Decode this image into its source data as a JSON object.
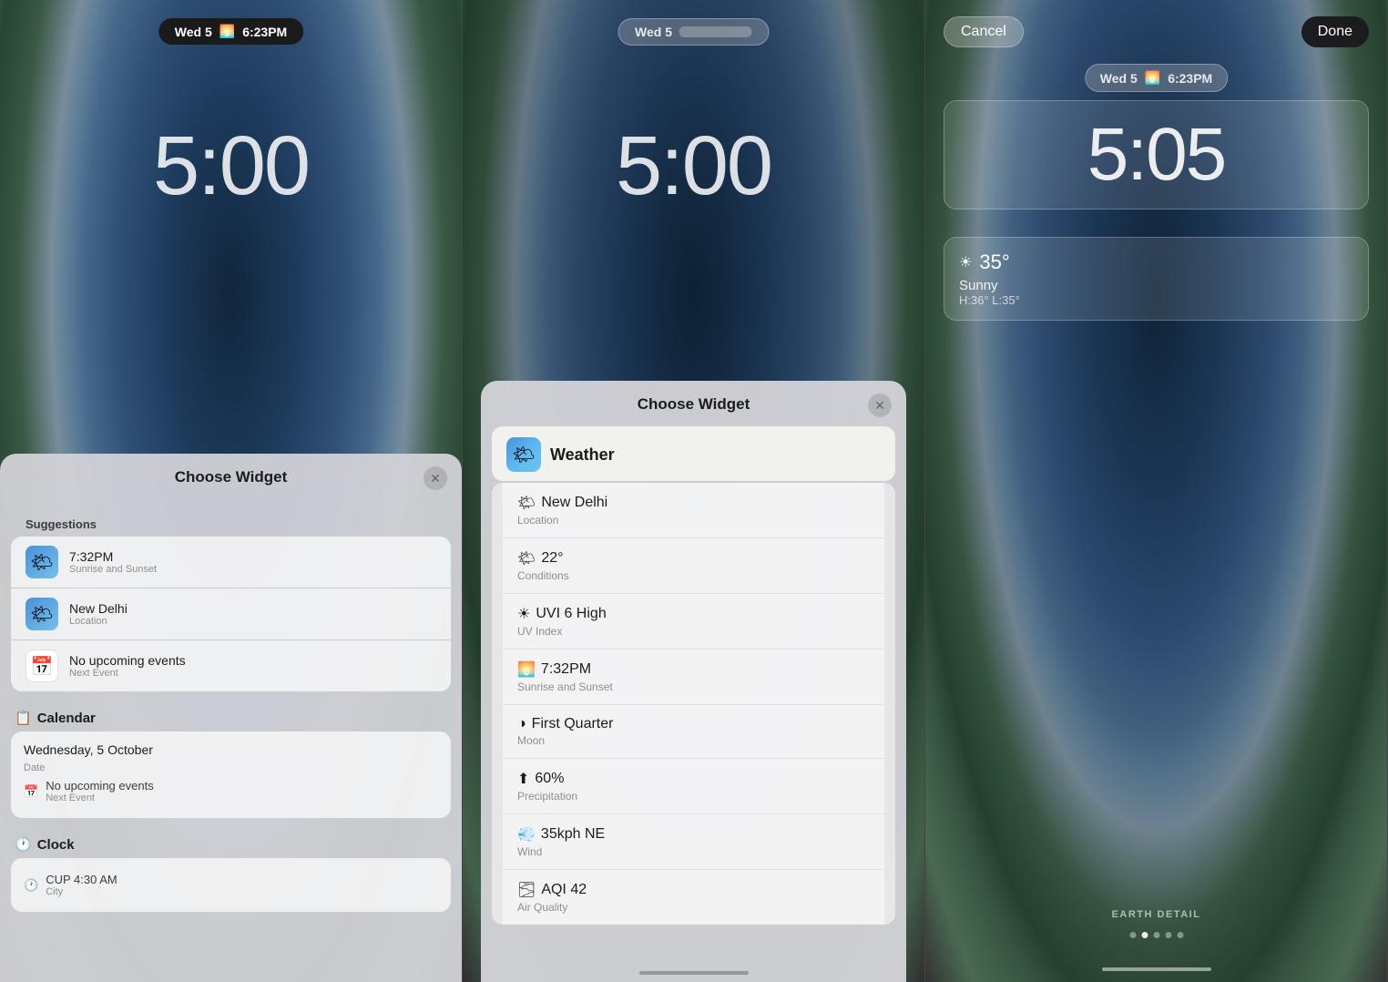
{
  "panels": [
    {
      "id": "panel1",
      "statusBar": {
        "text": "Wed 5",
        "time": "6:23PM",
        "icon": "🌅",
        "style": "dark"
      },
      "clock": "5:00",
      "sheet": {
        "title": "Choose Widget",
        "suggestions_label": "Suggestions",
        "items": [
          {
            "icon": "🌤",
            "type": "weather",
            "title": "7:32PM",
            "sub": "Sunrise and Sunset"
          },
          {
            "icon": "🌤",
            "type": "weather",
            "title": "New Delhi",
            "sub": "Location"
          },
          {
            "icon": "📅",
            "type": "calendar",
            "title": "No upcoming events",
            "sub": "Next Event"
          }
        ],
        "calendar_label": "Calendar",
        "calendar_date": "Wednesday, 5 October",
        "calendar_date_sub": "Date",
        "calendar_items": [
          {
            "icon": "📅",
            "title": "No upcoming events",
            "sub": "Next Event"
          }
        ],
        "clock_label": "Clock",
        "clock_items": [
          {
            "icon": "🕐",
            "title": "CUP 4:30 AM",
            "sub": "City"
          }
        ]
      }
    },
    {
      "id": "panel2",
      "statusBar": {
        "text": "Wed 5",
        "style": "light"
      },
      "clock": "5:00",
      "sheet": {
        "title": "Choose Widget",
        "app_name": "Weather",
        "app_icon": "🌤",
        "options": [
          {
            "icon": "🌤",
            "title": "New Delhi",
            "sub": "Location"
          },
          {
            "icon": "🌤",
            "title": "22°",
            "sub": "Conditions"
          },
          {
            "icon": "☀",
            "title": "UVI 6 High",
            "sub": "UV Index"
          },
          {
            "icon": "🌅",
            "title": "7:32PM",
            "sub": "Sunrise and Sunset"
          },
          {
            "icon": "◑",
            "title": "First Quarter",
            "sub": "Moon"
          },
          {
            "icon": "⬆",
            "title": "60%",
            "sub": "Precipitation"
          },
          {
            "icon": "💨",
            "title": "35kph NE",
            "sub": "Wind"
          },
          {
            "icon": "🌫",
            "title": "AQI 42",
            "sub": "Air Quality"
          }
        ]
      }
    },
    {
      "id": "panel3",
      "actions": {
        "cancel": "Cancel",
        "done": "Done"
      },
      "statusBar": {
        "text": "Wed 5",
        "time": "6:23PM",
        "icon": "🌅"
      },
      "clock": "5:05",
      "weather": {
        "icon": "☀",
        "temp": "35°",
        "condition": "Sunny",
        "hl": "H:36° L:35°"
      },
      "earth_detail": "EARTH DETAIL",
      "dots": [
        false,
        true,
        false,
        false,
        false
      ]
    }
  ]
}
